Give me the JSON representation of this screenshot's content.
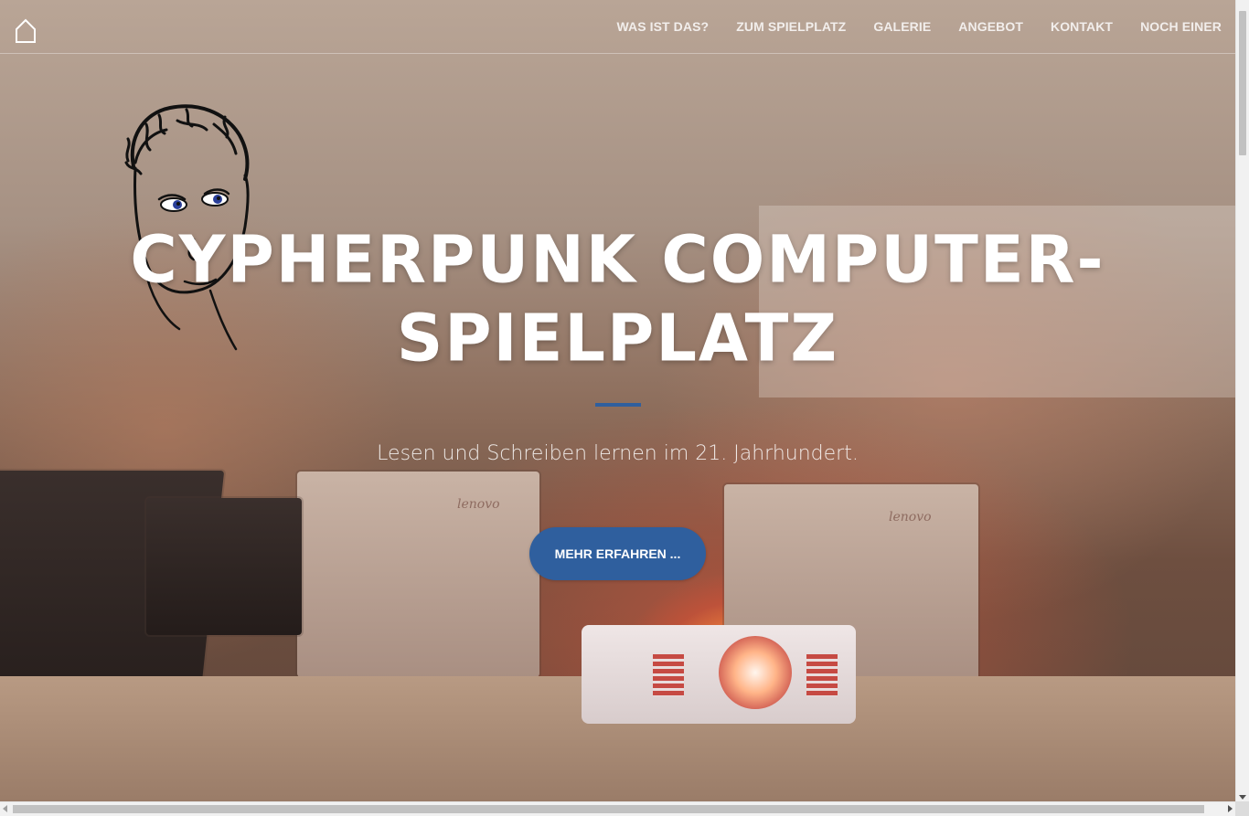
{
  "navbar": {
    "home_icon": "home-icon",
    "items": [
      {
        "label": "WAS IST DAS?"
      },
      {
        "label": "ZUM SPIELPLATZ"
      },
      {
        "label": "GALERIE"
      },
      {
        "label": "ANGEBOT"
      },
      {
        "label": "KONTAKT"
      },
      {
        "label": "NOCH EINER"
      }
    ]
  },
  "hero": {
    "title_line1": "CYPHERPUNK COMPUTER-",
    "title_line2": "SPIELPLATZ",
    "tagline": "Lesen und Schreiben lernen im 21. Jahrhundert.",
    "cta_label": "MEHR ERFAHREN ...",
    "mascot": "cartoon-face-icon",
    "laptop_brand": "lenovo"
  },
  "colors": {
    "accent": "#2f5f9e",
    "nav_text": "#ffffff",
    "title_text": "#ffffff"
  }
}
